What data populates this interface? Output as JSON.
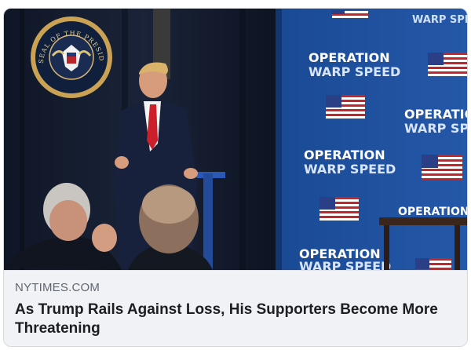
{
  "link_preview": {
    "domain": "NYTIMES.COM",
    "headline": "As Trump Rails Against Loss, His Supporters Become More Threatening"
  },
  "photo": {
    "seal_text": "SEAL OF THE PRESIDENT OF THE UNITED STATES",
    "backdrop_line1": "OPERATION",
    "backdrop_line2": "WARP SPEED",
    "backdrop_top_partial": "WARP SPEE"
  },
  "colors": {
    "card_background": "#f0f2f5",
    "domain_text": "#606770",
    "headline_text": "#1c1e21",
    "backdrop_blue": "#1d4f9c",
    "curtain_navy": "#141c30"
  }
}
